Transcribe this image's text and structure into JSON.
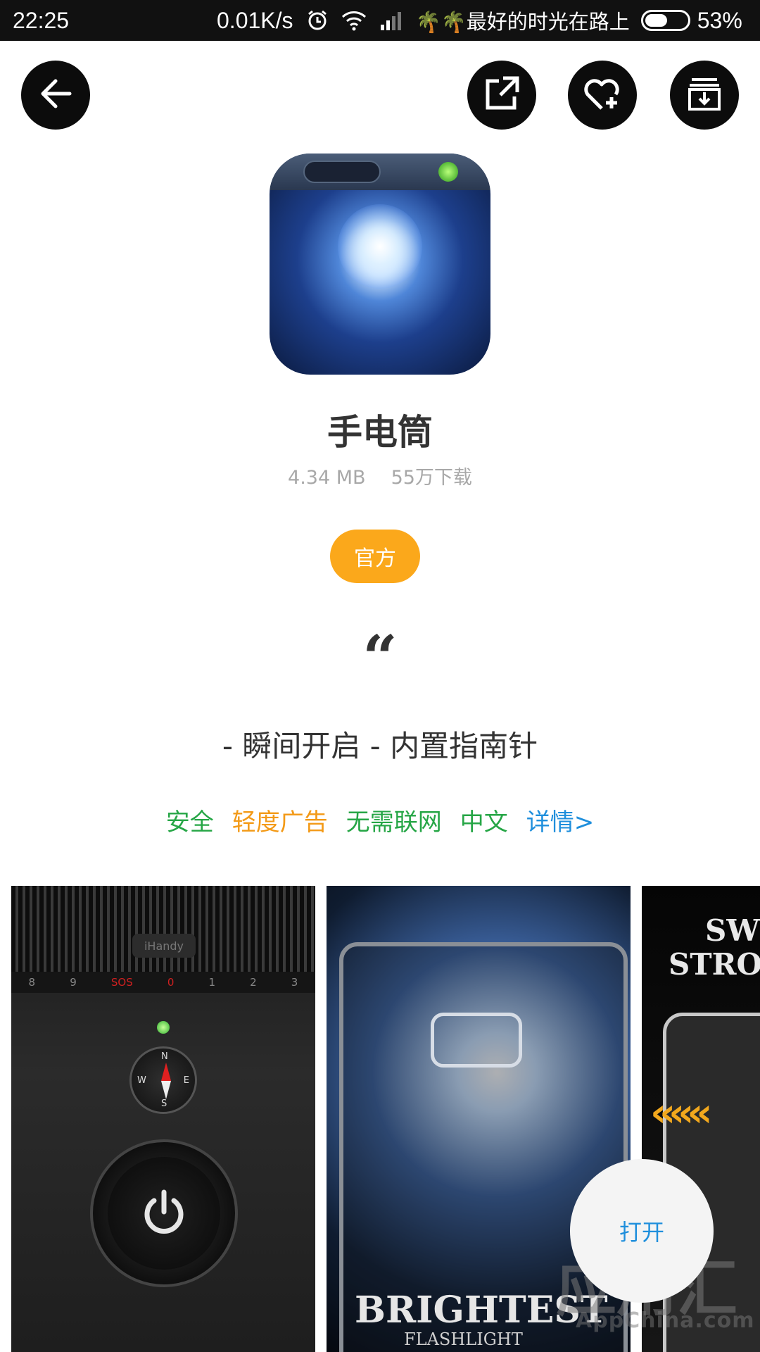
{
  "status_bar": {
    "time": "22:25",
    "net_speed": "0.01K/s",
    "carrier": "🌴🌴最好的时光在路上",
    "battery_pct": "53%",
    "battery_level": 0.53,
    "icons": [
      "alarm-icon",
      "wifi-icon",
      "signal-icon",
      "battery-icon"
    ]
  },
  "toolbar": {
    "icons": [
      "back-arrow-icon",
      "share-external-icon",
      "add-favorite-heart-icon",
      "download-box-icon"
    ]
  },
  "app": {
    "name": "手电筒",
    "size": "4.34 MB",
    "downloads": "55万下载",
    "badge": "官方",
    "quote_mark": "“",
    "slogan": "- 瞬间开启 - 内置指南针"
  },
  "tags": {
    "safe": "安全",
    "ads": "轻度广告",
    "offline": "无需联网",
    "chinese": "中文",
    "details": "详情>"
  },
  "screenshots": {
    "shot1": {
      "logo": "iHandy",
      "scale": [
        "8",
        "9",
        "SOS",
        "0",
        "1",
        "2",
        "3"
      ],
      "compass": {
        "n": "N",
        "s": "S",
        "w": "W",
        "e": "E"
      }
    },
    "shot2": {
      "brand": "BRIGHTEST",
      "subtitle": "FLASHLIGHT"
    },
    "shot3": {
      "title_line1": "SW",
      "title_line2": "STRO"
    }
  },
  "open_button": "打开",
  "watermark": {
    "text": "应用汇",
    "url": "AppChina.com"
  },
  "colors": {
    "badge": "#fba81b",
    "green": "#26a646",
    "orange": "#f39a17",
    "blue": "#1f8fdc"
  }
}
